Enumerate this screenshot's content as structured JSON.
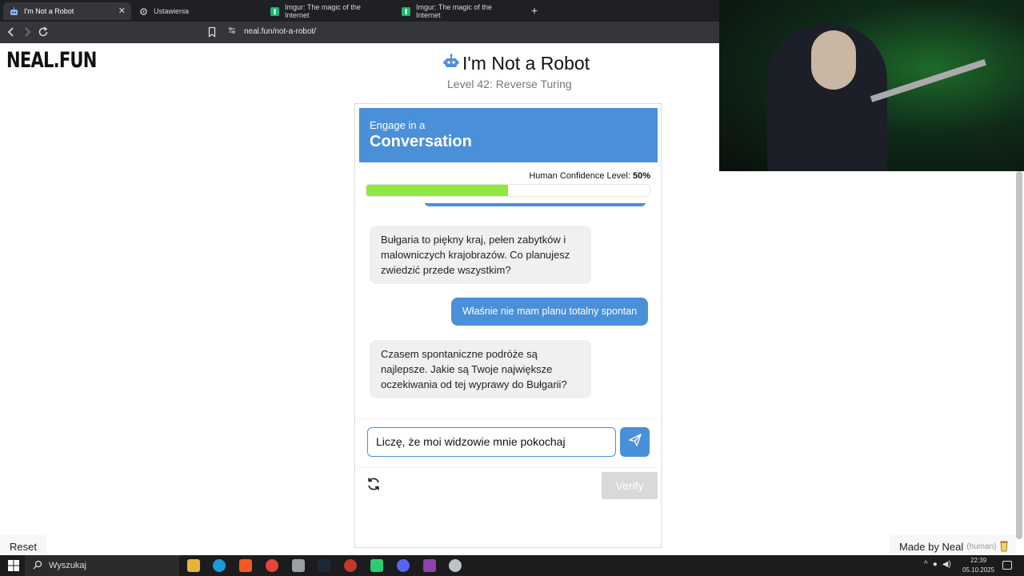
{
  "browser": {
    "tabs": [
      {
        "title": "I'm Not a Robot",
        "active": true,
        "icon": "robot-icon"
      },
      {
        "title": "Ustawienia",
        "active": false,
        "icon": "gear-icon"
      },
      {
        "title": "Imgur: The magic of the Internet",
        "active": false,
        "icon": "imgur-icon"
      },
      {
        "title": "Imgur: The magic of the Internet",
        "active": false,
        "icon": "imgur-icon"
      }
    ],
    "close_glyph": "✕",
    "new_tab_glyph": "+",
    "url": "neal.fun/not-a-robot/"
  },
  "page": {
    "logo": "NEAL.FUN",
    "title": "I'm Not a Robot",
    "subtitle": "Level 42: Reverse Turing",
    "card": {
      "header_small": "Engage in a",
      "header_big": "Conversation",
      "confidence_label": "Human Confidence Level:",
      "confidence_value": "50%",
      "confidence_fraction": 0.5
    },
    "messages": [
      {
        "from": "bot",
        "text": "Bułgaria to piękny kraj, pełen zabytków i malowniczych krajobrazów. Co planujesz zwiedzić przede wszystkim?"
      },
      {
        "from": "user",
        "text": "Właśnie nie mam planu totalny spontan"
      },
      {
        "from": "bot",
        "text": "Czasem spontaniczne podróże są najlepsze. Jakie są Twoje największe oczekiwania od tej wyprawy do Bułgarii?"
      }
    ],
    "input_value": "Liczę, że moi widzowie mnie pokochaj",
    "verify_label": "Verify",
    "reset_label": "Reset",
    "made_by": "Made by Neal",
    "made_by_note": "(human)"
  },
  "taskbar": {
    "search_placeholder": "Wyszukaj",
    "time": "22:39",
    "date": "05.10.2025"
  },
  "colors": {
    "accent": "#4a90d9",
    "progress": "#8fe842",
    "verify_disabled": "#d9d9d9"
  }
}
